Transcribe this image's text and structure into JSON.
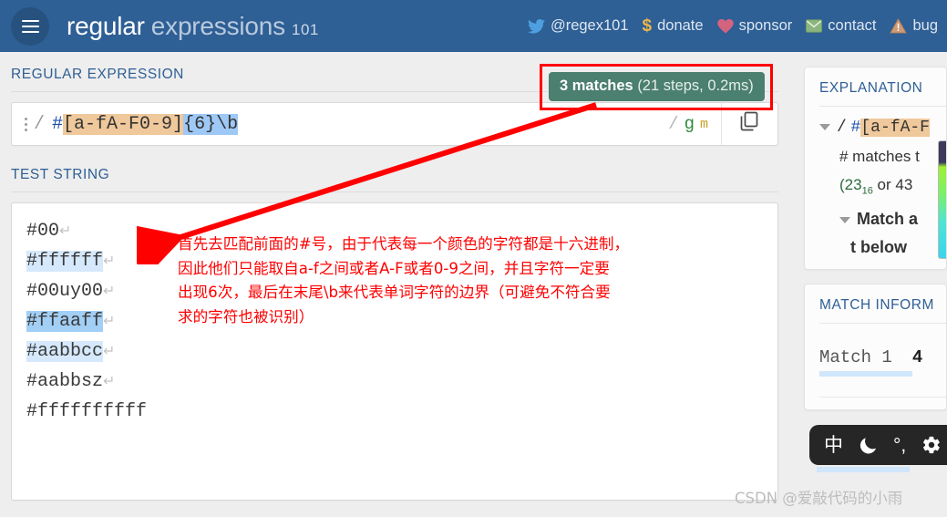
{
  "header": {
    "menu_icon": "hamburger-icon",
    "brand_bold": "regular",
    "brand_light": "expressions",
    "brand_num": "101",
    "nav": [
      {
        "icon": "twitter-icon",
        "label": "@regex101"
      },
      {
        "icon": "dollar-icon",
        "label": "donate"
      },
      {
        "icon": "heart-icon",
        "label": "sponsor"
      },
      {
        "icon": "envelope-icon",
        "label": "contact"
      },
      {
        "icon": "warning-triangle-icon",
        "label": "bug"
      }
    ]
  },
  "regex_section": {
    "title": "REGULAR EXPRESSION",
    "kebab_icon": "kebab-menu-icon",
    "delimiter": "/",
    "pattern_hash": "#",
    "pattern_class": "[a-fA-F0-9]",
    "pattern_quant": "{6}",
    "pattern_boundary": "\\b",
    "flags_slash": "/",
    "flag_g": "g",
    "flag_m": "m",
    "copy_icon": "copy-icon"
  },
  "match_badge": {
    "count_label": "3 matches",
    "details": "(21 steps, 0.2ms)",
    "color": "#4b7f6f",
    "annotation_box_color": "#ff0000"
  },
  "test_section": {
    "title": "TEST STRING",
    "lines": [
      {
        "text": "#00",
        "highlight": "none",
        "pilcrow": true
      },
      {
        "text": "#ffffff",
        "highlight": "match",
        "pilcrow": true
      },
      {
        "text": "#00uy00",
        "highlight": "none",
        "pilcrow": true
      },
      {
        "text": "#ffaaff",
        "highlight": "active",
        "pilcrow": true
      },
      {
        "text": "#aabbcc",
        "highlight": "match",
        "pilcrow": true
      },
      {
        "text": "#aabbsz",
        "highlight": "none",
        "pilcrow": true
      },
      {
        "text": "#ffffffffff",
        "highlight": "none",
        "pilcrow": false
      }
    ]
  },
  "annotation": {
    "color": "#ff0000",
    "line1": "首先去匹配前面的#号，由于代表每一个颜色的字符都是十六进制，",
    "line2": "因此他们只能取自a-f之间或者A-F或者0-9之间，并且字符一定要",
    "line3": "出现6次，最后在末尾\\b来代表单词字符的边界（可避免不符合要",
    "line4": "求的字符也被识别）"
  },
  "explanation_panel": {
    "title": "EXPLANATION",
    "row1_delim": "/",
    "row1_hash": "#",
    "row1_class": "[a-fA-F",
    "row2": "# matches t",
    "row3_open": "(23",
    "row3_sub": "16",
    "row3_rest": " or 43",
    "row4": "Match a",
    "row5": "t below"
  },
  "match_info_panel": {
    "title": "MATCH INFORM",
    "match_label": "Match 1",
    "match_value": "4"
  },
  "dark_toolbar": {
    "items": [
      {
        "icon": "language-icon",
        "glyph": "中"
      },
      {
        "icon": "dark-mode-moon-icon",
        "glyph": "☾"
      },
      {
        "icon": "regex-delimiter-icon",
        "glyph": "°,"
      },
      {
        "icon": "gear-icon",
        "glyph": "⚙"
      }
    ]
  },
  "watermark": {
    "text": "CSDN @爱敲代码的小雨"
  }
}
